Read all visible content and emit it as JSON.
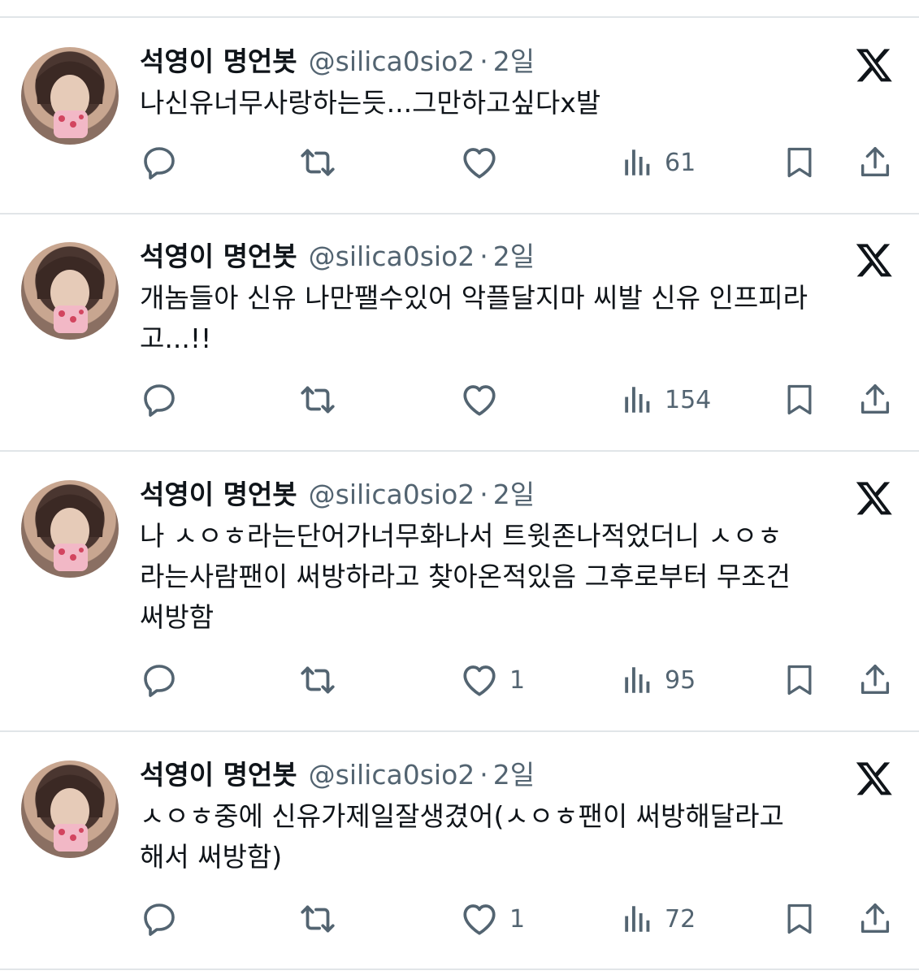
{
  "tweets": [
    {
      "author": {
        "name": "석영이 명언봇",
        "handle": "@silica0sio2",
        "separator": "·",
        "time": "2일"
      },
      "text": "나신유너무사랑하는듯...그만하고싶다x발",
      "metrics": {
        "replies": "",
        "retweets": "",
        "likes": "",
        "views": "61"
      }
    },
    {
      "author": {
        "name": "석영이 명언봇",
        "handle": "@silica0sio2",
        "separator": "·",
        "time": "2일"
      },
      "text": "개놈들아 신유 나만팰수있어 악플달지마 씨발 신유 인프피라\n고...!!",
      "metrics": {
        "replies": "",
        "retweets": "",
        "likes": "",
        "views": "154"
      }
    },
    {
      "author": {
        "name": "석영이 명언봇",
        "handle": "@silica0sio2",
        "separator": "·",
        "time": "2일"
      },
      "text": "나 ㅅㅇㅎ라는단어가너무화나서 트윗존나적었더니 ㅅㅇㅎ\n라는사람팬이 써방하라고 찾아온적있음 그후로부터 무조건\n써방함",
      "metrics": {
        "replies": "",
        "retweets": "",
        "likes": "1",
        "views": "95"
      }
    },
    {
      "author": {
        "name": "석영이 명언봇",
        "handle": "@silica0sio2",
        "separator": "·",
        "time": "2일"
      },
      "text": "ㅅㅇㅎ중에 신유가제일잘생겼어(ㅅㅇㅎ팬이 써방해달라고\n해서 써방함)",
      "metrics": {
        "replies": "",
        "retweets": "",
        "likes": "1",
        "views": "72"
      }
    }
  ],
  "icons": {
    "reply": "reply-icon",
    "retweet": "retweet-icon",
    "like": "heart-icon",
    "views": "views-icon",
    "bookmark": "bookmark-icon",
    "share": "share-icon",
    "brand": "x-logo-icon"
  },
  "colors": {
    "text": "#0f1419",
    "secondary": "#536471",
    "divider": "#e1e5e8",
    "background": "#ffffff"
  }
}
